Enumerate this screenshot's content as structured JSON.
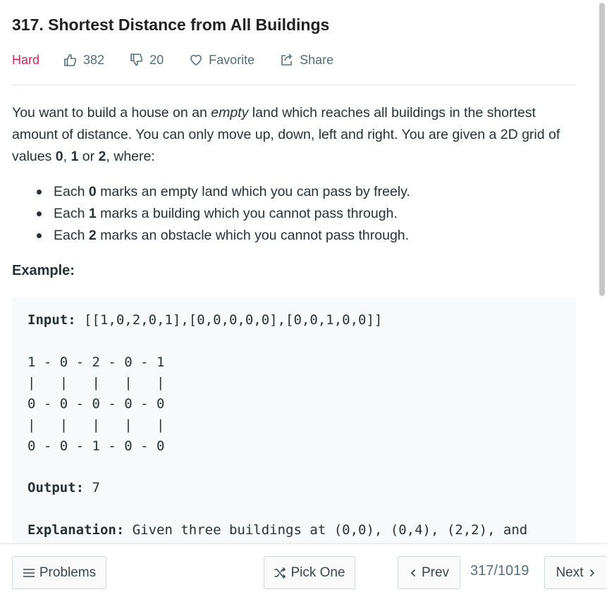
{
  "problem": {
    "title": "317. Shortest Distance from All Buildings",
    "difficulty": "Hard",
    "likes": "382",
    "dislikes": "20",
    "favorite_label": "Favorite",
    "share_label": "Share"
  },
  "description": {
    "intro_part1": "You want to build a house on an ",
    "intro_em": "empty",
    "intro_part2": " land which reaches all buildings in the shortest amount of distance. You can only move up, down, left and right. You are given a 2D grid of values ",
    "v0": "0",
    "sep1": ", ",
    "v1": "1",
    "sep2": " or ",
    "v2": "2",
    "intro_end": ", where:",
    "bullets": [
      {
        "pre": "Each ",
        "bold": "0",
        "post": " marks an empty land which you can pass by freely."
      },
      {
        "pre": "Each ",
        "bold": "1",
        "post": " marks a building which you cannot pass through."
      },
      {
        "pre": "Each ",
        "bold": "2",
        "post": " marks an obstacle which you cannot pass through."
      }
    ]
  },
  "example": {
    "label": "Example:",
    "input_label": "Input:",
    "input_value": " [[1,0,2,0,1],[0,0,0,0,0],[0,0,1,0,0]]",
    "grid_lines": [
      "1 - 0 - 2 - 0 - 1",
      "|   |   |   |   |",
      "0 - 0 - 0 - 0 - 0",
      "|   |   |   |   |",
      "0 - 0 - 1 - 0 - 0"
    ],
    "output_label": "Output:",
    "output_value": " 7",
    "explanation_label": "Explanation:",
    "explanation_value": " Given three buildings at (0,0), (0,4), (2,2), and"
  },
  "bottom_bar": {
    "problems_label": "Problems",
    "pick_one_label": "Pick One",
    "prev_label": "Prev",
    "counter": "317/1019",
    "next_label": "Next"
  }
}
